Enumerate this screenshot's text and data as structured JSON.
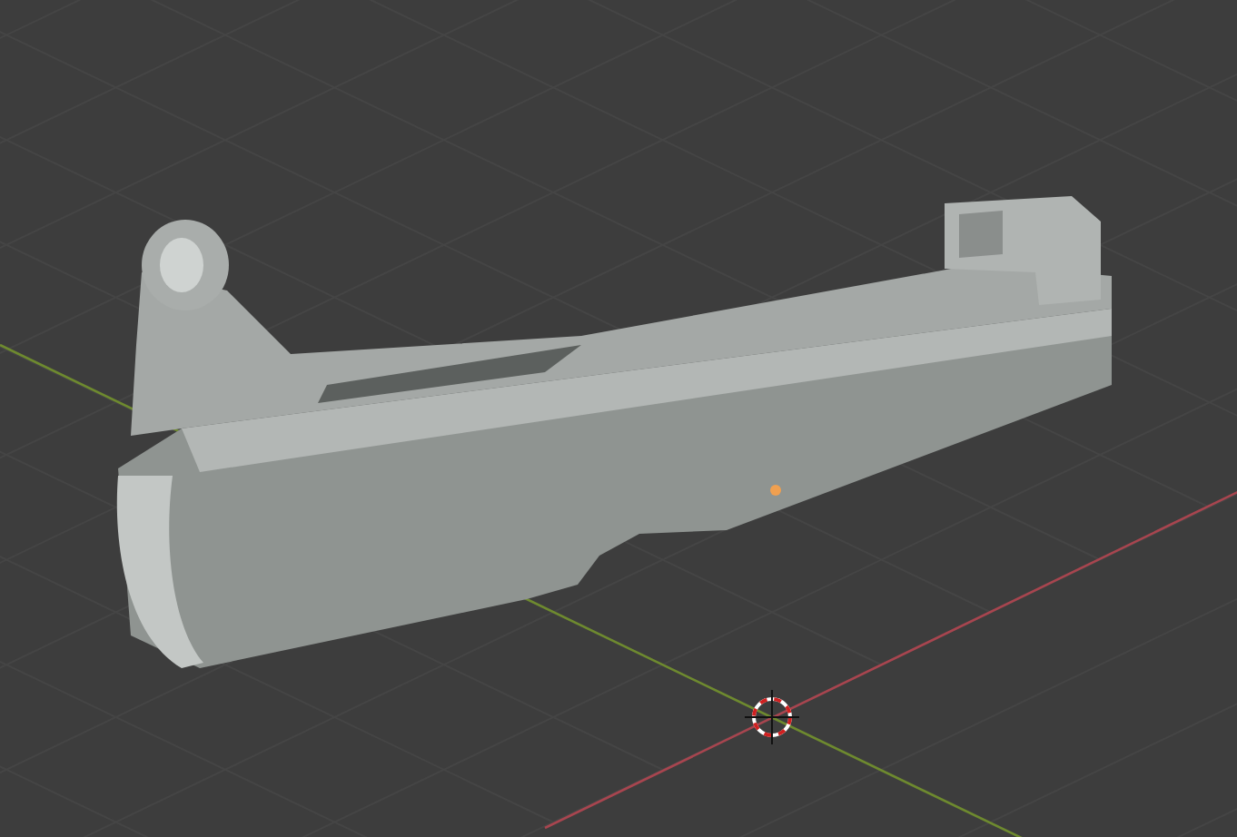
{
  "viewport": {
    "axes": [
      {
        "kind": "x",
        "color": "#a8454f"
      },
      {
        "kind": "y",
        "color": "#6e8a2f"
      }
    ],
    "origin_point": true,
    "cursor": true
  }
}
